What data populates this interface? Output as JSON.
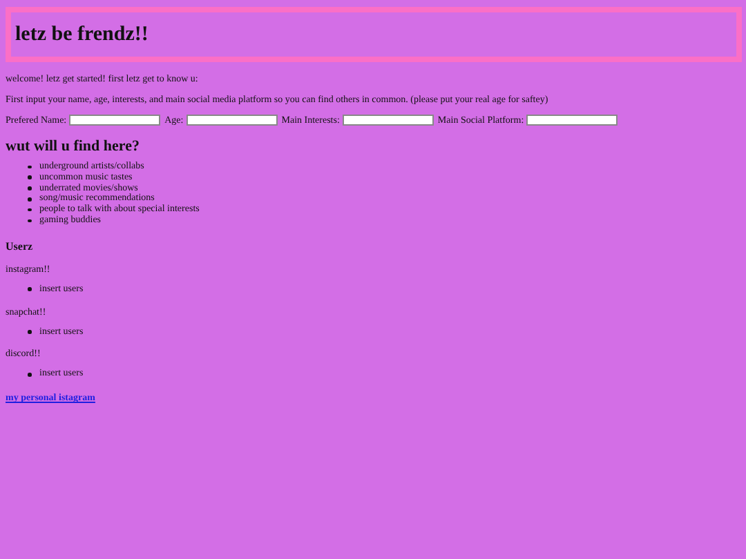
{
  "header": {
    "title": "letz be frendz!!"
  },
  "intro": [
    "welcome! letz get started! first letz get to know u:",
    "First input your name, age, interests, and main social media platform so you can find others in common. (please put your real age for saftey)"
  ],
  "form": {
    "fields": [
      {
        "label": "Prefered Name:"
      },
      {
        "label": "Age:"
      },
      {
        "label": "Main Interests:"
      },
      {
        "label": "Main Social Platform:"
      }
    ]
  },
  "find": {
    "heading": "wut will u find here?",
    "items": [
      "underground artists/collabs",
      "uncommon music tastes",
      "underrated movies/shows",
      "song/music recommendations",
      "people to talk with about special interests",
      "gaming buddies"
    ]
  },
  "users": {
    "heading": "Userz",
    "groups": [
      {
        "platform": "instagram!!",
        "items": [
          "insert users"
        ]
      },
      {
        "platform": "snapchat!!",
        "items": [
          "insert users"
        ]
      },
      {
        "platform": "discord!!",
        "items": [
          "insert users"
        ]
      }
    ]
  },
  "link": "my personal istagram"
}
